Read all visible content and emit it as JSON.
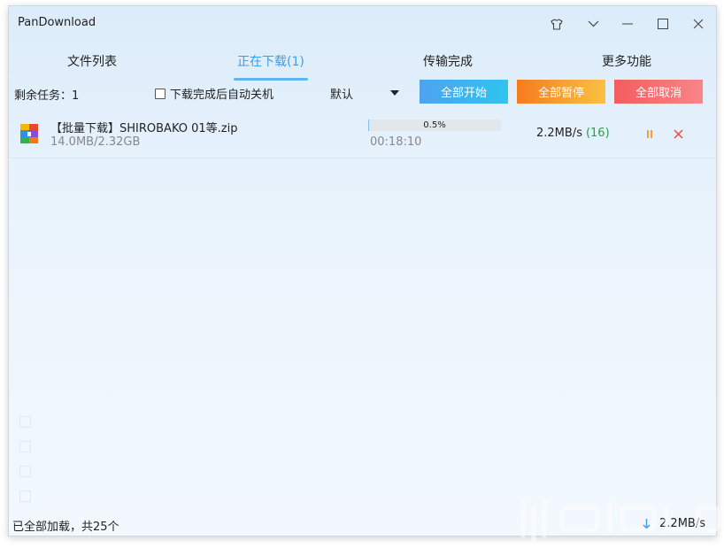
{
  "window": {
    "title": "PanDownload"
  },
  "tabs": [
    {
      "label": "文件列表",
      "active": false
    },
    {
      "label": "正在下载(1)",
      "active": true
    },
    {
      "label": "传输完成",
      "active": false
    },
    {
      "label": "更多功能",
      "active": false
    }
  ],
  "toolbar": {
    "remaining": "剩余任务：1",
    "auto_shutdown_label": "下载完成后自动关机",
    "auto_shutdown_checked": false,
    "sort_value": "默认",
    "start_all": "全部开始",
    "pause_all": "全部暂停",
    "cancel_all": "全部取消"
  },
  "downloads": [
    {
      "name": "【批量下载】SHIROBAKO 01等.zip",
      "size": "14.0MB/2.32GB",
      "progress_percent": 0.5,
      "progress_label": "0.5%",
      "eta": "00:18:10",
      "speed": "2.2MB/s",
      "connections": "(16)"
    }
  ],
  "status": {
    "text": "已全部加载，共25个",
    "total_speed": "2.2MB/s"
  },
  "colors": {
    "accent": "#3f9de8",
    "start_btn": "#4ea3ef",
    "pause_btn": "#f77b1f",
    "cancel_btn": "#f35d5f",
    "connections": "#22a24a"
  }
}
